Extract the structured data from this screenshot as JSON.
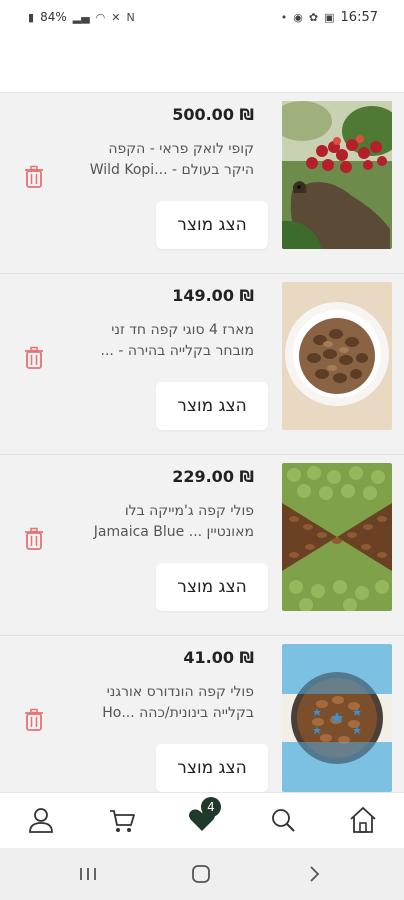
{
  "status_bar": {
    "battery": "84%",
    "time": "16:57"
  },
  "products": [
    {
      "price": "₪ 500.00",
      "title_line1": "קופי לואק פראי - הקפה",
      "title_line2": "היקר בעולם - ...Wild Kopi",
      "button_label": "הצג מוצר",
      "image": "civet-coffee-cherries"
    },
    {
      "price": "₪ 149.00",
      "title_line1": "מארז 4 סוגי קפה חד זני",
      "title_line2": "מובחר בקלייה בהירה - ...",
      "button_label": "הצג מוצר",
      "image": "roasted-beans-bowl"
    },
    {
      "price": "₪ 229.00",
      "title_line1": "פולי קפה ג'מייקה בלו",
      "title_line2": "מאונטיין ... Jamaica Blue",
      "button_label": "הצג מוצר",
      "image": "green-and-roasted-beans"
    },
    {
      "price": "₪ 41.00",
      "title_line1": "פולי קפה הונדורס אורגני",
      "title_line2": "בקלייה בינונית/כהה ...Ho",
      "button_label": "הצג מוצר",
      "image": "honduras-flag-beans"
    }
  ],
  "bottom_nav": {
    "items": [
      "user-icon",
      "cart-icon",
      "favorites-icon",
      "search-icon",
      "home-icon"
    ],
    "favorites_badge": "4"
  },
  "colors": {
    "list_background": "#f2f2f2",
    "trash": "#e57373",
    "badge": "#1f3a2a",
    "accent_dark": "#1f3a2a"
  }
}
